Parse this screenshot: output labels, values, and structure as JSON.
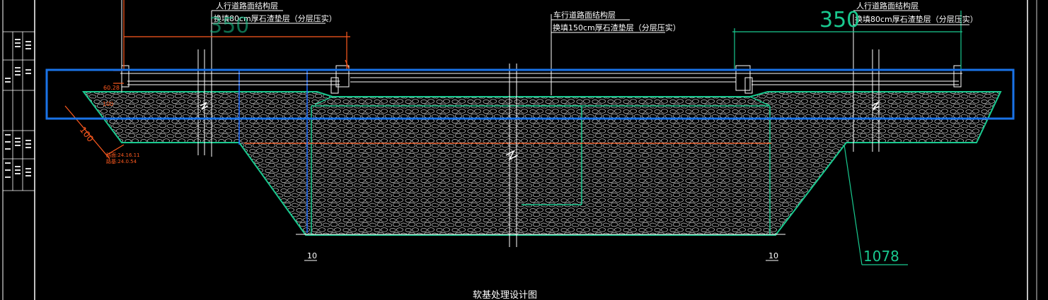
{
  "drawing": {
    "title": "软基处理设计图",
    "colors": {
      "background": "#000000",
      "line": "#ffffff",
      "teal": "#19c98f",
      "orange": "#ff5a1f",
      "blue": "#1e6bff",
      "selection": "#1a73e8"
    }
  },
  "annotations": {
    "left_callout_title": "人行道路面结构层",
    "left_callout_body": "换填80cm厚石渣垫层（分层压实）",
    "center_callout_title": "车行道路面结构层",
    "center_callout_body": "换填150cm厚石渣垫层（分层压实）",
    "right_callout_title": "人行道路面结构层",
    "right_callout_body": "换填80cm厚石渣垫层（分层压实）"
  },
  "dimensions": {
    "left_width": "350",
    "right_width": "350",
    "right_leader": "1078",
    "left_elev_1": "60.28",
    "left_slope_len": "100",
    "left_elev_label_1": "路面:24.16.11",
    "left_elev_label_2": "路基:24.0.54",
    "bottom_left_mark": "10",
    "bottom_right_mark": "10",
    "left_small_mark": "100"
  }
}
